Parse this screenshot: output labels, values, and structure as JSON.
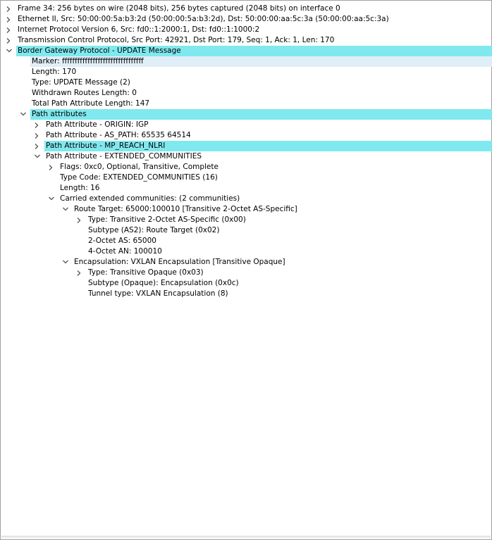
{
  "colors": {
    "selected": "#7fe9ef",
    "related": "#e0eef7",
    "toggle": "#555555"
  },
  "rows": [
    {
      "level": 0,
      "toggle": "collapsed",
      "highlight": "none",
      "label": "Frame 34: 256 bytes on wire (2048 bits), 256 bytes captured (2048 bits) on interface 0"
    },
    {
      "level": 0,
      "toggle": "collapsed",
      "highlight": "none",
      "label": "Ethernet II, Src: 50:00:00:5a:b3:2d (50:00:00:5a:b3:2d), Dst: 50:00:00:aa:5c:3a (50:00:00:aa:5c:3a)"
    },
    {
      "level": 0,
      "toggle": "collapsed",
      "highlight": "none",
      "label": "Internet Protocol Version 6, Src: fd0::1:2000:1, Dst: fd0::1:1000:2"
    },
    {
      "level": 0,
      "toggle": "collapsed",
      "highlight": "none",
      "label": "Transmission Control Protocol, Src Port: 42921, Dst Port: 179, Seq: 1, Ack: 1, Len: 170"
    },
    {
      "level": 0,
      "toggle": "expanded",
      "highlight": "selected",
      "label": "Border Gateway Protocol - UPDATE Message"
    },
    {
      "level": 1,
      "toggle": "none",
      "highlight": "related",
      "label": "Marker: ffffffffffffffffffffffffffffffff"
    },
    {
      "level": 1,
      "toggle": "none",
      "highlight": "none",
      "label": "Length: 170"
    },
    {
      "level": 1,
      "toggle": "none",
      "highlight": "none",
      "label": "Type: UPDATE Message (2)"
    },
    {
      "level": 1,
      "toggle": "none",
      "highlight": "none",
      "label": "Withdrawn Routes Length: 0"
    },
    {
      "level": 1,
      "toggle": "none",
      "highlight": "none",
      "label": "Total Path Attribute Length: 147"
    },
    {
      "level": 1,
      "toggle": "expanded",
      "highlight": "selected",
      "label": "Path attributes"
    },
    {
      "level": 2,
      "toggle": "collapsed",
      "highlight": "none",
      "label": "Path Attribute - ORIGIN: IGP"
    },
    {
      "level": 2,
      "toggle": "collapsed",
      "highlight": "none",
      "label": "Path Attribute - AS_PATH: 65535 64514"
    },
    {
      "level": 2,
      "toggle": "collapsed",
      "highlight": "selected",
      "label": "Path Attribute - MP_REACH_NLRI"
    },
    {
      "level": 2,
      "toggle": "expanded",
      "highlight": "none",
      "label": "Path Attribute - EXTENDED_COMMUNITIES"
    },
    {
      "level": 3,
      "toggle": "collapsed",
      "highlight": "none",
      "label": "Flags: 0xc0, Optional, Transitive, Complete"
    },
    {
      "level": 3,
      "toggle": "none",
      "highlight": "none",
      "label": "Type Code: EXTENDED_COMMUNITIES (16)"
    },
    {
      "level": 3,
      "toggle": "none",
      "highlight": "none",
      "label": "Length: 16"
    },
    {
      "level": 3,
      "toggle": "expanded",
      "highlight": "none",
      "label": "Carried extended communities: (2 communities)"
    },
    {
      "level": 4,
      "toggle": "expanded",
      "highlight": "none",
      "label": "Route Target: 65000:100010 [Transitive 2-Octet AS-Specific]"
    },
    {
      "level": 5,
      "toggle": "collapsed",
      "highlight": "none",
      "label": "Type: Transitive 2-Octet AS-Specific (0x00)"
    },
    {
      "level": 5,
      "toggle": "none",
      "highlight": "none",
      "label": "Subtype (AS2): Route Target (0x02)"
    },
    {
      "level": 5,
      "toggle": "none",
      "highlight": "none",
      "label": "2-Octet AS: 65000"
    },
    {
      "level": 5,
      "toggle": "none",
      "highlight": "none",
      "label": "4-Octet AN: 100010"
    },
    {
      "level": 4,
      "toggle": "expanded",
      "highlight": "none",
      "label": "Encapsulation: VXLAN Encapsulation [Transitive Opaque]"
    },
    {
      "level": 5,
      "toggle": "collapsed",
      "highlight": "none",
      "label": "Type: Transitive Opaque (0x03)"
    },
    {
      "level": 5,
      "toggle": "none",
      "highlight": "none",
      "label": "Subtype (Opaque): Encapsulation (0x0c)"
    },
    {
      "level": 5,
      "toggle": "none",
      "highlight": "none",
      "label": "Tunnel type: VXLAN Encapsulation (8)"
    }
  ]
}
